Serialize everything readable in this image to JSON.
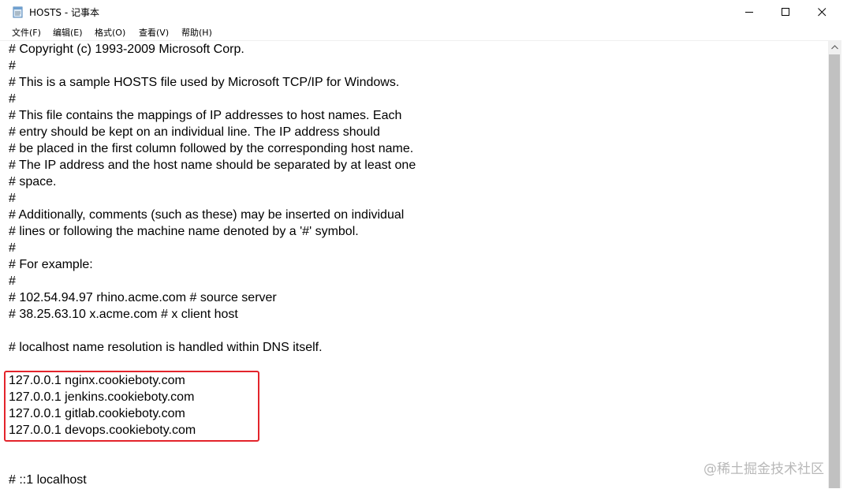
{
  "window": {
    "title": "HOSTS - 记事本",
    "icon": "notepad-icon"
  },
  "menu": [
    {
      "label": "文件(F)"
    },
    {
      "label": "编辑(E)"
    },
    {
      "label": "格式(O)"
    },
    {
      "label": "查看(V)"
    },
    {
      "label": "帮助(H)"
    }
  ],
  "content": {
    "lines": [
      "# Copyright (c) 1993-2009 Microsoft Corp.",
      "#",
      "# This is a sample HOSTS file used by Microsoft TCP/IP for Windows.",
      "#",
      "# This file contains the mappings of IP addresses to host names. Each",
      "# entry should be kept on an individual line. The IP address should",
      "# be placed in the first column followed by the corresponding host name.",
      "# The IP address and the host name should be separated by at least one",
      "# space.",
      "#",
      "# Additionally, comments (such as these) may be inserted on individual",
      "# lines or following the machine name denoted by a '#' symbol.",
      "#",
      "# For example:",
      "#",
      "# 102.54.94.97 rhino.acme.com # source server",
      "# 38.25.63.10 x.acme.com # x client host",
      "",
      "# localhost name resolution is handled within DNS itself.",
      "",
      "127.0.0.1 nginx.cookieboty.com",
      "127.0.0.1 jenkins.cookieboty.com",
      "127.0.0.1 gitlab.cookieboty.com",
      "127.0.0.1 devops.cookieboty.com",
      "",
      "",
      "# ::1 localhost"
    ]
  },
  "highlight_color": "#e3242b",
  "watermark": "@稀土掘金技术社区"
}
